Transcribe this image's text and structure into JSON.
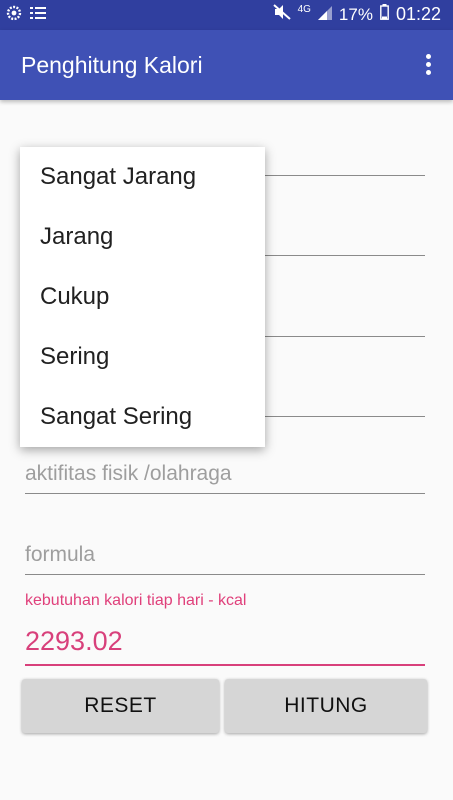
{
  "status_bar": {
    "left_icons": [
      "settings-gear-icon",
      "list-icon"
    ],
    "right_icons": [
      "mute-icon",
      "4g-icon",
      "signal-icon",
      "battery-icon"
    ],
    "network": "4G",
    "battery": "17%",
    "time": "01:22"
  },
  "app_bar": {
    "title": "Penghitung Kalori",
    "overflow_icon": "more-vert-icon"
  },
  "form": {
    "activity_placeholder": "aktifitas fisik /olahraga",
    "formula_placeholder": "formula",
    "result_label": "kebutuhan kalori tiap hari - kcal",
    "result_value": "2293.02"
  },
  "buttons": {
    "reset": "RESET",
    "calculate": "HITUNG"
  },
  "dropdown": {
    "options": [
      "Sangat Jarang",
      "Jarang",
      "Cukup",
      "Sering",
      "Sangat Sering"
    ]
  },
  "colors": {
    "status_bar": "#303f9f",
    "app_bar": "#3f51b5",
    "accent": "#d8407b",
    "button": "#d6d6d6"
  }
}
